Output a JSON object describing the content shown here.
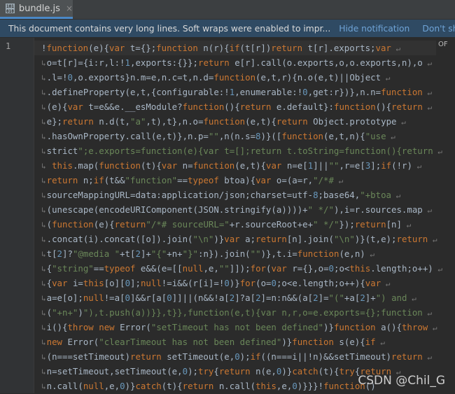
{
  "tab": {
    "icon": "js-file-icon",
    "label": "bundle.js",
    "close": "×"
  },
  "notification": {
    "message": "This document contains very long lines. Soft wraps were enabled to impr...",
    "hide": "Hide notification",
    "dont_show": "Don't show again"
  },
  "gutter": {
    "line_number": "1"
  },
  "scroll_label": "OF",
  "code_lines": [
    "!function(e){var t={};function n(r){if(t[r])return t[r].exports;var",
    "o=t[r]={i:r,l:!1,exports:{}};return e[r].call(o.exports,o,o.exports,n),o",
    ".l=!0,o.exports}n.m=e,n.c=t,n.d=function(e,t,r){n.o(e,t)||Object",
    ".defineProperty(e,t,{configurable:!1,enumerable:!0,get:r})},n.n=function",
    "(e){var t=e&&e.__esModule?function(){return e.default}:function(){return",
    "e};return n.d(t,\"a\",t),t},n.o=function(e,t){return Object.prototype",
    ".hasOwnProperty.call(e,t)},n.p=\"\",n(n.s=8)}([function(e,t,n){\"use",
    "strict\";e.exports=function(e){var t=[];return t.toString=function(){return",
    " this.map(function(t){var n=function(e,t){var n=e[1]||\"\",r=e[3];if(!r)",
    "return n;if(t&&\"function\"==typeof btoa){var o=(a=r,\"/*#",
    "sourceMappingURL=data:application/json;charset=utf-8;base64,\"+btoa",
    "(unescape(encodeURIComponent(JSON.stringify(a))))+\" */\"),i=r.sources.map",
    "(function(e){return\"/*# sourceURL=\"+r.sourceRoot+e+\" */\"});return[n]",
    ".concat(i).concat([o]).join(\"\\n\")}var a;return[n].join(\"\\n\")}(t,e);return",
    "t[2]?\"@media \"+t[2]+\"{\"+n+\"}\":n}).join(\"\")},t.i=function(e,n)",
    "{\"string\"==typeof e&&(e=[[null,e,\"\"]]);for(var r={},o=0;o<this.length;o++)",
    "{var i=this[o][0];null!=i&&(r[i]=!0)}for(o=0;o<e.length;o++){var",
    "a=e[o];null!=a[0]&&r[a[0]]||(n&&!a[2]?a[2]=n:n&&(a[2]=\"(\"+a[2]+\") and",
    "(\"+n+\")\"),t.push(a))}},t}},function(e,t){var n,r,o=e.exports={};function",
    "i(){throw new Error(\"setTimeout has not been defined\")}function a(){throw",
    "new Error(\"clearTimeout has not been defined\")}function s(e){if",
    "(n===setTimeout)return setTimeout(e,0);if((n===i||!n)&&setTimeout)return",
    "n=setTimeout,setTimeout(e,0);try{return n(e,0)}catch(t){try{return",
    "n.call(null,e,0)}catch(t){return n.call(this,e,0)}}}!function()"
  ],
  "watermark": "CSDN @Chil_G",
  "colors": {
    "keyword": "#cc7832",
    "string": "#6a8759",
    "number": "#6897bb",
    "text": "#a9b7c6",
    "notification_bg": "#2f4a63",
    "link": "#6fa3d6"
  }
}
